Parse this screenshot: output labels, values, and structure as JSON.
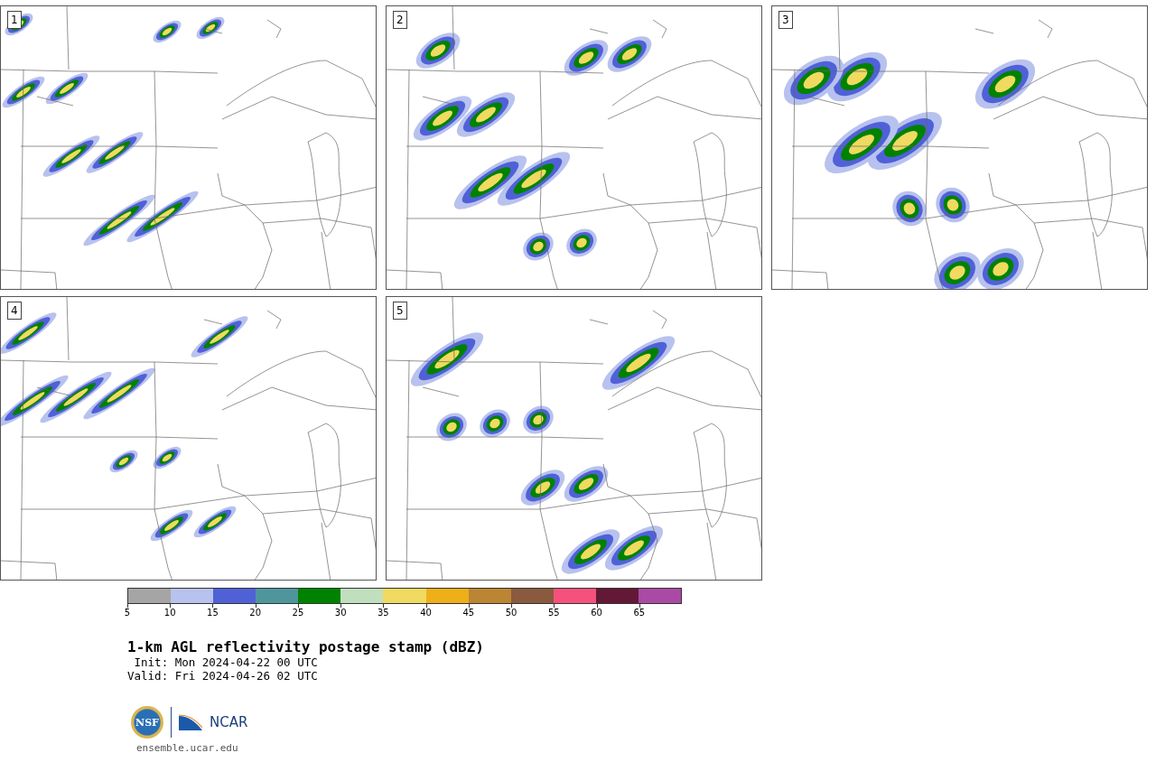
{
  "panels": [
    {
      "label": "1"
    },
    {
      "label": "2"
    },
    {
      "label": "3"
    },
    {
      "label": "4"
    },
    {
      "label": "5"
    }
  ],
  "colorbar": {
    "segments": [
      {
        "color": "#a5a5a5"
      },
      {
        "color": "#b8c2ee"
      },
      {
        "color": "#5061d8"
      },
      {
        "color": "#4f969c"
      },
      {
        "color": "#008200"
      },
      {
        "color": "#c0dfbe"
      },
      {
        "color": "#f0da60"
      },
      {
        "color": "#efaf18"
      },
      {
        "color": "#bc8533"
      },
      {
        "color": "#8a5a3e"
      },
      {
        "color": "#f4527c"
      },
      {
        "color": "#631836"
      },
      {
        "color": "#aa4aa4"
      }
    ],
    "ticks": [
      "5",
      "10",
      "15",
      "20",
      "25",
      "30",
      "35",
      "40",
      "45",
      "50",
      "55",
      "60",
      "65"
    ]
  },
  "title": "1-km AGL reflectivity postage stamp (dBZ)",
  "init": " Init: Mon 2024-04-22 00 UTC",
  "valid": "Valid: Fri 2024-04-26 02 UTC",
  "logo": {
    "left": "NSF",
    "right": "NCAR"
  },
  "site": "ensemble.ucar.edu"
}
